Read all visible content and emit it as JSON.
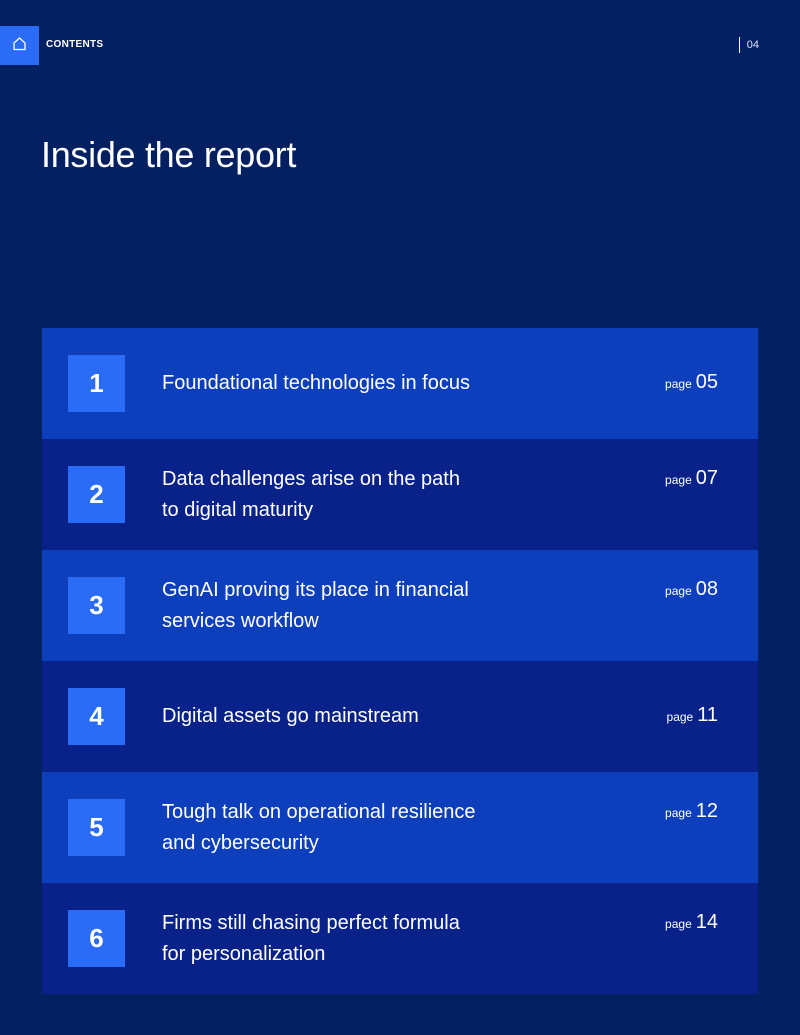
{
  "header": {
    "section_label": "CONTENTS",
    "page_number": "04"
  },
  "title": "Inside the report",
  "toc": [
    {
      "number": "1",
      "title": "Foundational technologies in focus",
      "page_word": "page",
      "page": "05"
    },
    {
      "number": "2",
      "title": "Data challenges arise on the path to digital maturity",
      "page_word": "page",
      "page": "07"
    },
    {
      "number": "3",
      "title": "GenAI proving its place in financial services workflow",
      "page_word": "page",
      "page": "08"
    },
    {
      "number": "4",
      "title": "Digital assets go mainstream",
      "page_word": "page",
      "page": "11"
    },
    {
      "number": "5",
      "title": "Tough talk on operational resilience and cybersecurity",
      "page_word": "page",
      "page": "12"
    },
    {
      "number": "6",
      "title": "Firms still chasing perfect formula for personalization",
      "page_word": "page",
      "page": "14"
    }
  ],
  "colors": {
    "background": "#052060",
    "accent": "#2a6cf5",
    "row_light": "#0d3fbc",
    "row_dark": "#08228a"
  },
  "icons": {
    "home": "home-icon"
  }
}
